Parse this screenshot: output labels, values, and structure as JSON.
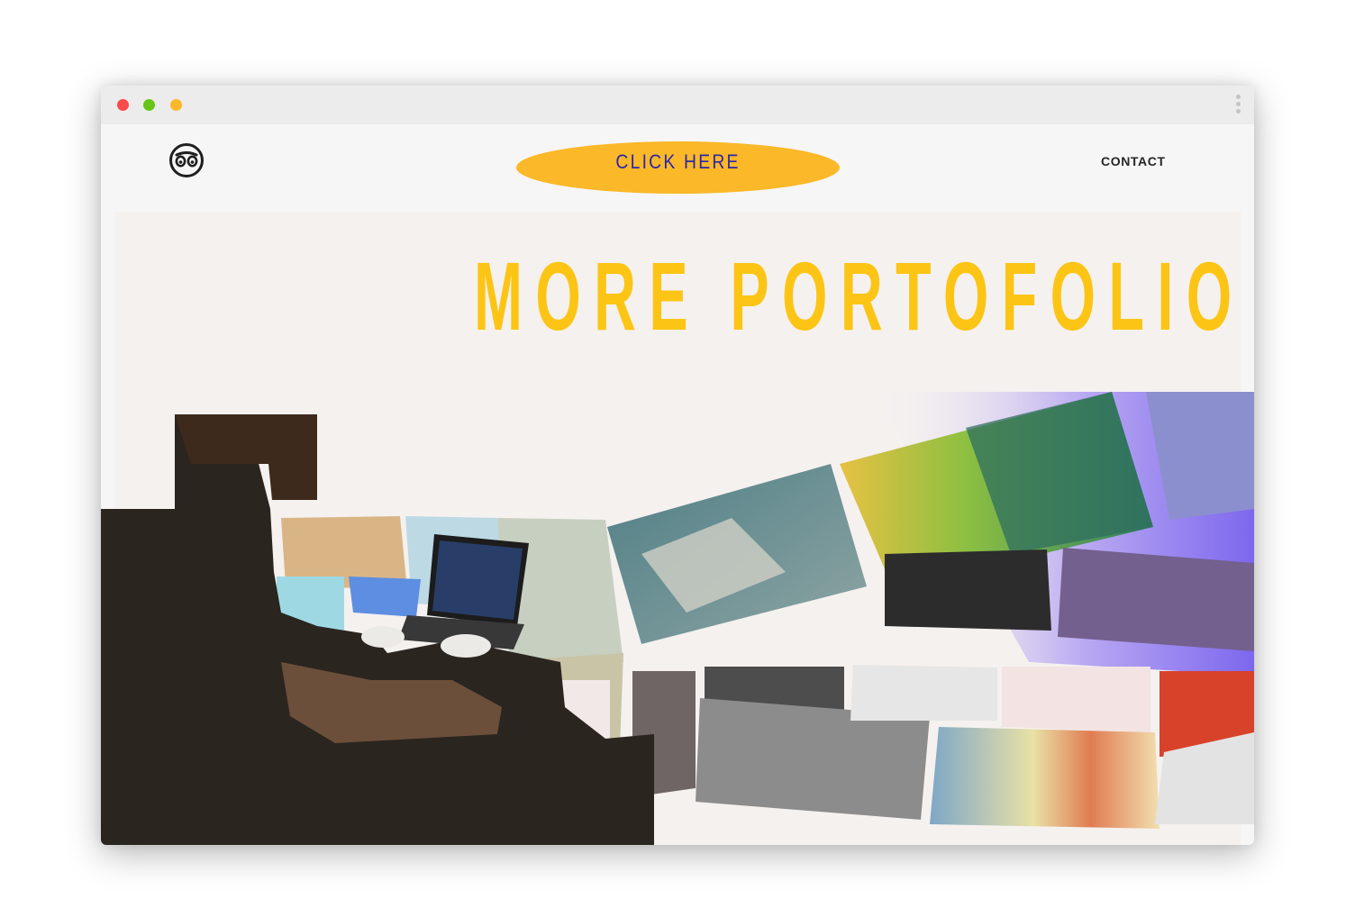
{
  "window": {
    "controls": [
      "close",
      "minimize",
      "maximize"
    ],
    "control_colors": {
      "close": "#fb4a4a",
      "minimize": "#66c415",
      "maximize": "#fbb828"
    },
    "menu_icon": "kebab-menu-icon"
  },
  "header": {
    "logo_icon": "owl-face-icon",
    "cta_label": "CLICK HERE",
    "cta_color": "#fbb828",
    "cta_text_color": "#2c27a6",
    "contact_label": "CONTACT"
  },
  "hero": {
    "title": "MORE PORTOFOLIO",
    "title_color": "#fcc515",
    "background": "#f5f1ef",
    "images": [
      "person-at-laptop-photo",
      "map-collage-image"
    ]
  }
}
